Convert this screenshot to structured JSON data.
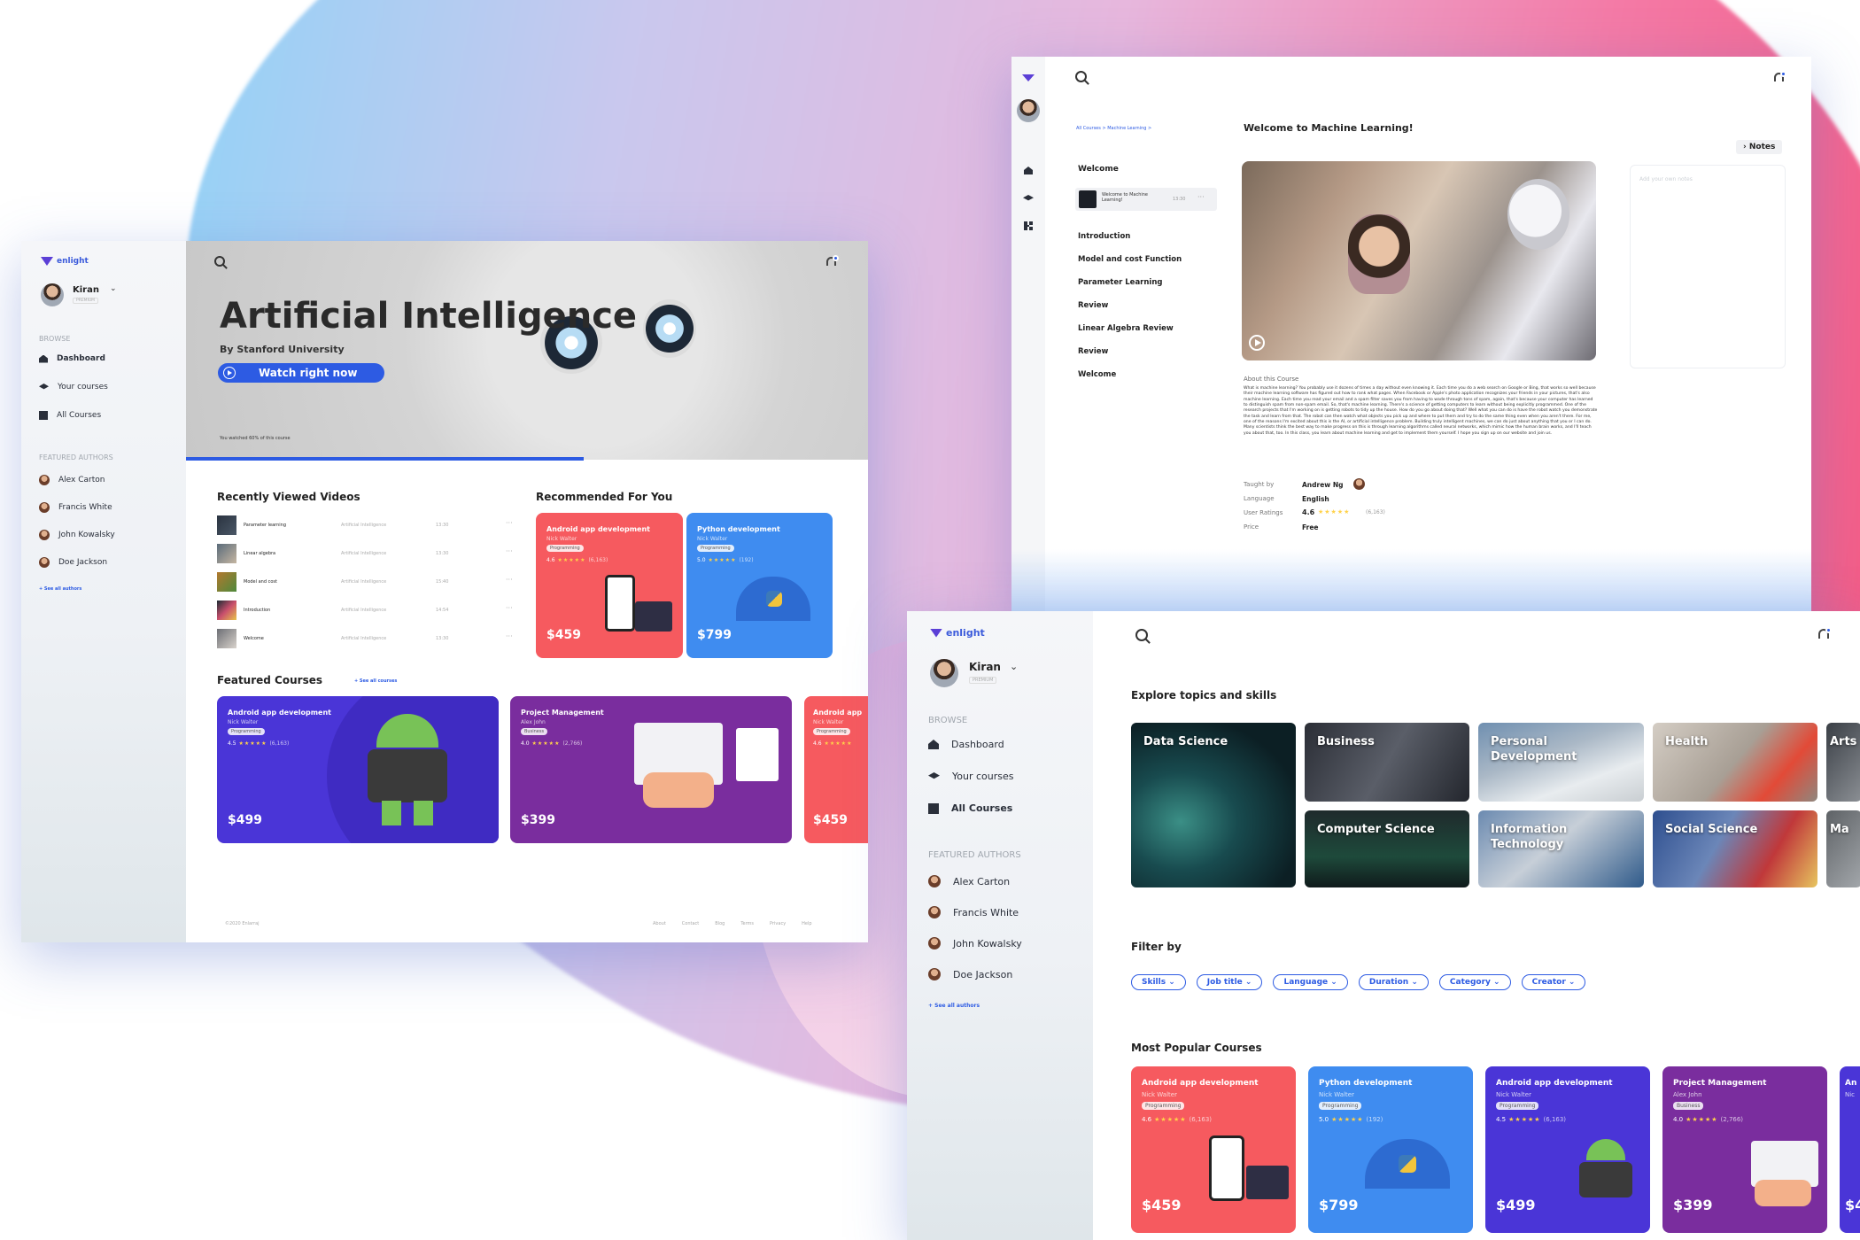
{
  "brand": {
    "name": "enlight",
    "accent": "#2d5be3"
  },
  "w1": {
    "user": {
      "name": "Kiran",
      "plan": "PREMIUM"
    },
    "browse_label": "BROWSE",
    "nav": [
      "Dashboard",
      "Your courses",
      "All Courses"
    ],
    "featured_label": "FEATURED AUTHORS",
    "authors": [
      "Alex Carton",
      "Francis White",
      "John Kowalsky",
      "Doe Jackson"
    ],
    "see_all_authors": "+ See all authors",
    "hero": {
      "title": "Artificial Intelligence",
      "subtitle": "By Stanford University",
      "cta": "Watch right now",
      "progress_text": "You watched 60% of this course",
      "progress": 0.6
    },
    "recent_title": "Recently Viewed Videos",
    "recent": [
      {
        "title": "Parameter learning",
        "course": "Artificial Intelligence",
        "time": "13:30"
      },
      {
        "title": "Linear algebra",
        "course": "Artificial Intelligence",
        "time": "13:30"
      },
      {
        "title": "Model and cost",
        "course": "Artificial Intelligence",
        "time": "15:40"
      },
      {
        "title": "Introduction",
        "course": "Artificial Intelligence",
        "time": "14:54"
      },
      {
        "title": "Welcome",
        "course": "Artificial Intelligence",
        "time": "13:30"
      }
    ],
    "rec_title": "Recommended For You",
    "rec": [
      {
        "title": "Android app development",
        "author": "Nick Walter",
        "tag": "Programming",
        "rating": "4.6",
        "count": "(6,163)",
        "price": "$459"
      },
      {
        "title": "Python development",
        "author": "Nick Walter",
        "tag": "Programming",
        "rating": "5.0",
        "count": "(192)",
        "price": "$799"
      }
    ],
    "featured_title": "Featured Courses",
    "see_all_courses": "+ See all courses",
    "featured": [
      {
        "title": "Android app development",
        "author": "Nick Walter",
        "tag": "Programming",
        "rating": "4.5",
        "count": "(6,163)",
        "price": "$499"
      },
      {
        "title": "Project Management",
        "author": "Alex John",
        "tag": "Business",
        "rating": "4.0",
        "count": "(2,766)",
        "price": "$399"
      },
      {
        "title": "Android app",
        "author": "Nick Walter",
        "tag": "Programming",
        "rating": "4.6",
        "count": "",
        "price": "$459"
      }
    ],
    "footer": {
      "copyright": "©2020 Enlarraj",
      "links": [
        "About",
        "Contact",
        "Blog",
        "Terms",
        "Privacy",
        "Help"
      ]
    }
  },
  "w2": {
    "breadcrumb": "All Courses > Machine Learning >",
    "lessons_head": "Welcome",
    "current_lesson": {
      "title": "Welcome to Machine Learning!",
      "time": "13:30"
    },
    "lessons": [
      "Introduction",
      "Model and cost Function",
      "Parameter Learning",
      "Review",
      "Linear Algebra Review",
      "Review",
      "Welcome"
    ],
    "title": "Welcome to Machine Learning!",
    "notes_label": "Notes",
    "notes_placeholder": "Add your own notes",
    "about_label": "About this Course",
    "about_text": "What is machine learning? You probably use it dozens of times a day without even knowing it. Each time you do a web search on Google or Bing, that works so well because their machine learning software has figured out how to rank what pages. When Facebook or Apple's photo application recognizes your friends in your pictures, that's also machine learning. Each time you read your email and a spam filter saves you from having to wade through tons of spam, again, that's because your computer has learned to distinguish spam from non-spam email. So, that's machine learning. There's a science of getting computers to learn without being explicitly programmed. One of the research projects that I'm working on is getting robots to tidy up the house. How do you go about doing that? Well what you can do is have the robot watch you demonstrate the task and learn from that. The robot can then watch what objects you pick up and where to put them and try to do the same thing even when you aren't there. For me, one of the reasons I'm excited about this is the AI, or artificial intelligence problem. Building truly intelligent machines, we can do just about anything that you or I can do. Many scientists think the best way to make progress on this is through learning algorithms called neural networks, which mimic how the human brain works, and I'll teach you about that, too. In this class, you learn about machine learning and get to implement them yourself. I hope you sign up on our website and join us.",
    "meta": [
      {
        "label": "Taught by",
        "value": "Andrew Ng"
      },
      {
        "label": "Language",
        "value": "English"
      },
      {
        "label": "User Ratings",
        "value": "4.6",
        "extra": "(6,163)"
      },
      {
        "label": "Price",
        "value": "Free"
      }
    ]
  },
  "w3": {
    "user": {
      "name": "Kiran",
      "plan": "PREMIUM"
    },
    "browse_label": "BROWSE",
    "nav": [
      "Dashboard",
      "Your courses",
      "All Courses"
    ],
    "featured_label": "FEATURED AUTHORS",
    "authors": [
      "Alex Carton",
      "Francis White",
      "John Kowalsky",
      "Doe Jackson"
    ],
    "see_all_authors": "+ See all authors",
    "explore_title": "Explore topics and skills",
    "topics": [
      "Data Science",
      "Business",
      "Personal Development",
      "Health",
      "Arts",
      "Computer Science",
      "Information Technology",
      "Social Science",
      "Ma"
    ],
    "filter_title": "Filter by",
    "filters": [
      "Skills",
      "Job title",
      "Language",
      "Duration",
      "Category",
      "Creator"
    ],
    "popular_title": "Most Popular Courses",
    "popular": [
      {
        "title": "Android app development",
        "author": "Nick Walter",
        "tag": "Programming",
        "rating": "4.6",
        "count": "(6,163)",
        "price": "$459"
      },
      {
        "title": "Python development",
        "author": "Nick Walter",
        "tag": "Programming",
        "rating": "5.0",
        "count": "(192)",
        "price": "$799"
      },
      {
        "title": "Android app development",
        "author": "Nick Walter",
        "tag": "Programming",
        "rating": "4.5",
        "count": "(6,163)",
        "price": "$499"
      },
      {
        "title": "Project Management",
        "author": "Alex John",
        "tag": "Business",
        "rating": "4.0",
        "count": "(2,766)",
        "price": "$399"
      },
      {
        "title": "An",
        "author": "Nic",
        "tag": "",
        "rating": "",
        "count": "",
        "price": "$4"
      }
    ]
  }
}
